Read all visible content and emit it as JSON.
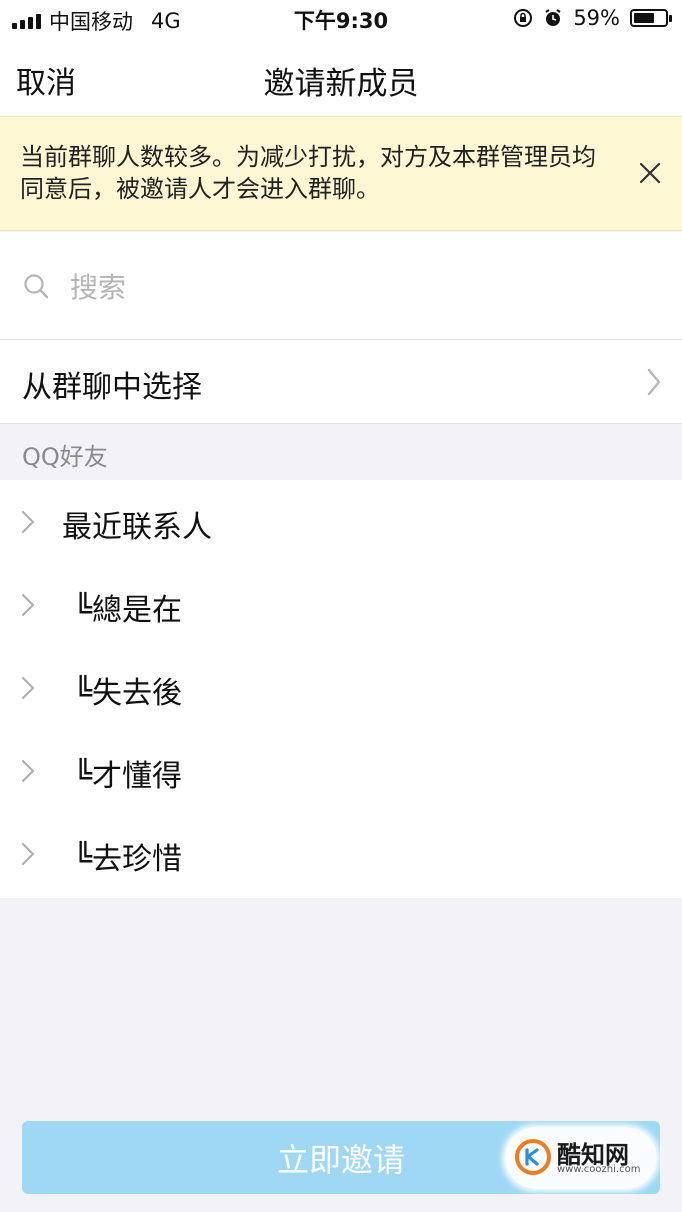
{
  "status_bar": {
    "carrier": "中国移动",
    "network": "4G",
    "time": "下午9:30",
    "battery_percent": "59%",
    "battery_level": 0.59
  },
  "nav": {
    "cancel_label": "取消",
    "title": "邀请新成员"
  },
  "notice": {
    "text": "当前群聊人数较多。为减少打扰，对方及本群管理员均同意后，被邀请人才会进入群聊。"
  },
  "search": {
    "placeholder": "搜索"
  },
  "select_from_group": {
    "label": "从群聊中选择"
  },
  "section": {
    "header": "QQ好友"
  },
  "friends": {
    "groups": [
      {
        "label": "最近联系人"
      },
      {
        "label": "╚總是在"
      },
      {
        "label": "╚失去後"
      },
      {
        "label": "╚才懂得"
      },
      {
        "label": "╚去珍惜"
      }
    ]
  },
  "invite_button": {
    "label": "立即邀请"
  },
  "watermark": {
    "name": "酷知网",
    "url": "www.coozhi.com"
  },
  "colors": {
    "notice_bg": "#fdf7d4",
    "button_bg": "#9fd8f5",
    "page_bg": "#f3f3f7"
  }
}
